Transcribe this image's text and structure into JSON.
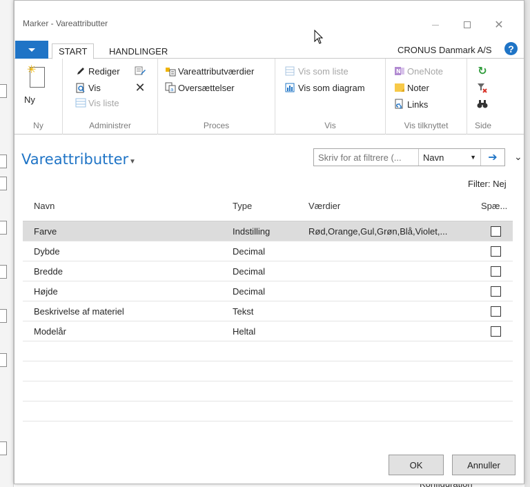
{
  "window": {
    "title": "Marker - Vareattributter"
  },
  "ribbon": {
    "tabs": [
      {
        "label": "START",
        "active": true
      },
      {
        "label": "HANDLINGER",
        "active": false
      }
    ],
    "company": "CRONUS Danmark A/S",
    "groups": {
      "ny": {
        "label": "Ny",
        "new_button": "Ny"
      },
      "administrer": {
        "label": "Administrer",
        "edit": "Rediger",
        "view": "Vis",
        "view_list": "Vis liste"
      },
      "proces": {
        "label": "Proces",
        "values": "Vareattributværdier",
        "translations": "Oversættelser"
      },
      "vis": {
        "label": "Vis",
        "show_as_list": "Vis som liste",
        "show_as_chart": "Vis som diagram"
      },
      "vis_tilknyttet": {
        "label": "Vis tilknyttet",
        "onenote": "OneNote",
        "notes": "Noter",
        "links": "Links"
      },
      "side": {
        "label": "Side"
      }
    }
  },
  "list": {
    "title": "Vareattributter",
    "filter": {
      "placeholder": "Skriv for at filtrere (...",
      "field": "Navn"
    },
    "filter_status": "Filter: Nej",
    "columns": {
      "navn": "Navn",
      "type": "Type",
      "vaerdier": "Værdier",
      "spaerret": "Spæ..."
    },
    "rows": [
      {
        "navn": "Farve",
        "type": "Indstilling",
        "vaerdier": "Rød,Orange,Gul,Grøn,Blå,Violet,...",
        "spaerret": false,
        "selected": true
      },
      {
        "navn": "Dybde",
        "type": "Decimal",
        "vaerdier": "",
        "spaerret": false,
        "selected": false
      },
      {
        "navn": "Bredde",
        "type": "Decimal",
        "vaerdier": "",
        "spaerret": false,
        "selected": false
      },
      {
        "navn": "Højde",
        "type": "Decimal",
        "vaerdier": "",
        "spaerret": false,
        "selected": false
      },
      {
        "navn": "Beskrivelse af materiel",
        "type": "Tekst",
        "vaerdier": "",
        "spaerret": false,
        "selected": false
      },
      {
        "navn": "Modelår",
        "type": "Heltal",
        "vaerdier": "",
        "spaerret": false,
        "selected": false
      }
    ]
  },
  "buttons": {
    "ok": "OK",
    "cancel": "Annuller"
  },
  "background": {
    "partial_text": "Konfiguration"
  },
  "colors": {
    "accent": "#1f74c6",
    "selected_row": "#dcdcdc"
  }
}
